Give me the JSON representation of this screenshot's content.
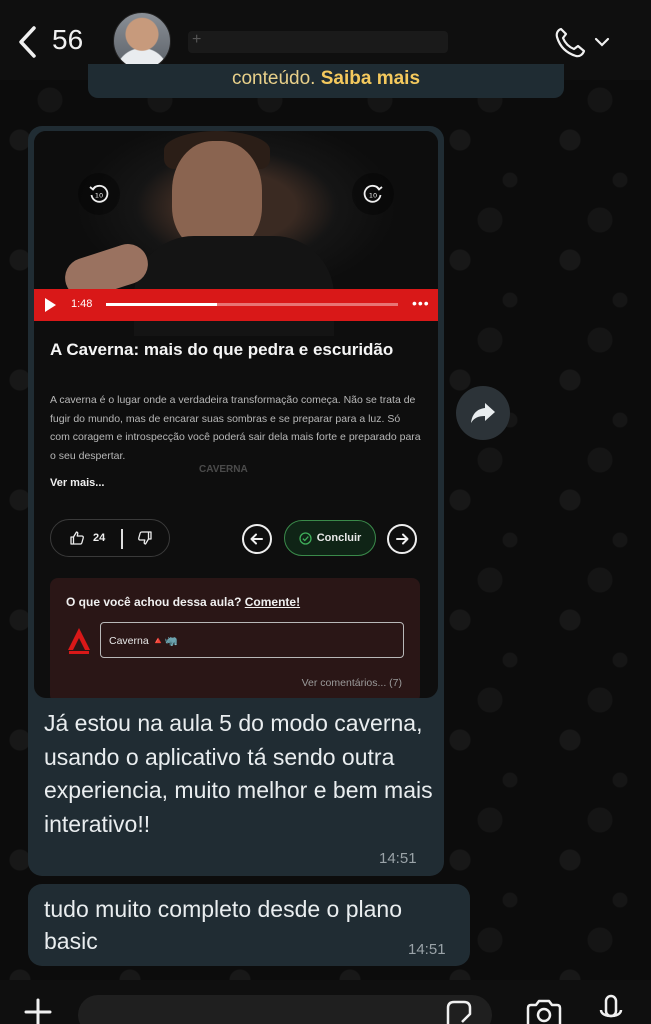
{
  "header": {
    "unread_count": "56",
    "contact_name": "+"
  },
  "previous_message": {
    "text": "conteúdo. ",
    "link": "Saiba mais"
  },
  "lesson_screenshot": {
    "video": {
      "current_time": "1:48",
      "progress": 0.38,
      "watermark": "CAVERNA",
      "skip_label": "10"
    },
    "title": "A Caverna: mais do que pedra e escuridão",
    "description": "A caverna é o lugar onde a verdadeira transformação começa. Não se trata de fugir do mundo, mas de encarar suas sombras e se preparar para a luz. Só com coragem e introspecção você poderá sair dela mais forte e preparado para o seu despertar.",
    "see_more": "Ver mais...",
    "likes": "24",
    "conclude_label": "Concluir",
    "feedback": {
      "question": "O que você achou dessa aula? ",
      "comment_link": "Comente!",
      "input_value": "Caverna 🔺🦏",
      "view_comments": "Ver comentários... (7)"
    }
  },
  "messages": [
    {
      "text": "Já estou na aula 5 do modo caverna, usando o aplicativo tá sendo outra experiencia, muito melhor e bem mais interativo!!",
      "time": "14:51"
    },
    {
      "text": "tudo muito completo desde o plano basic",
      "time": "14:51"
    }
  ],
  "colors": {
    "accent_red": "#d91818",
    "bubble": "#202c33",
    "conclude_green": "#3a8a4a"
  }
}
